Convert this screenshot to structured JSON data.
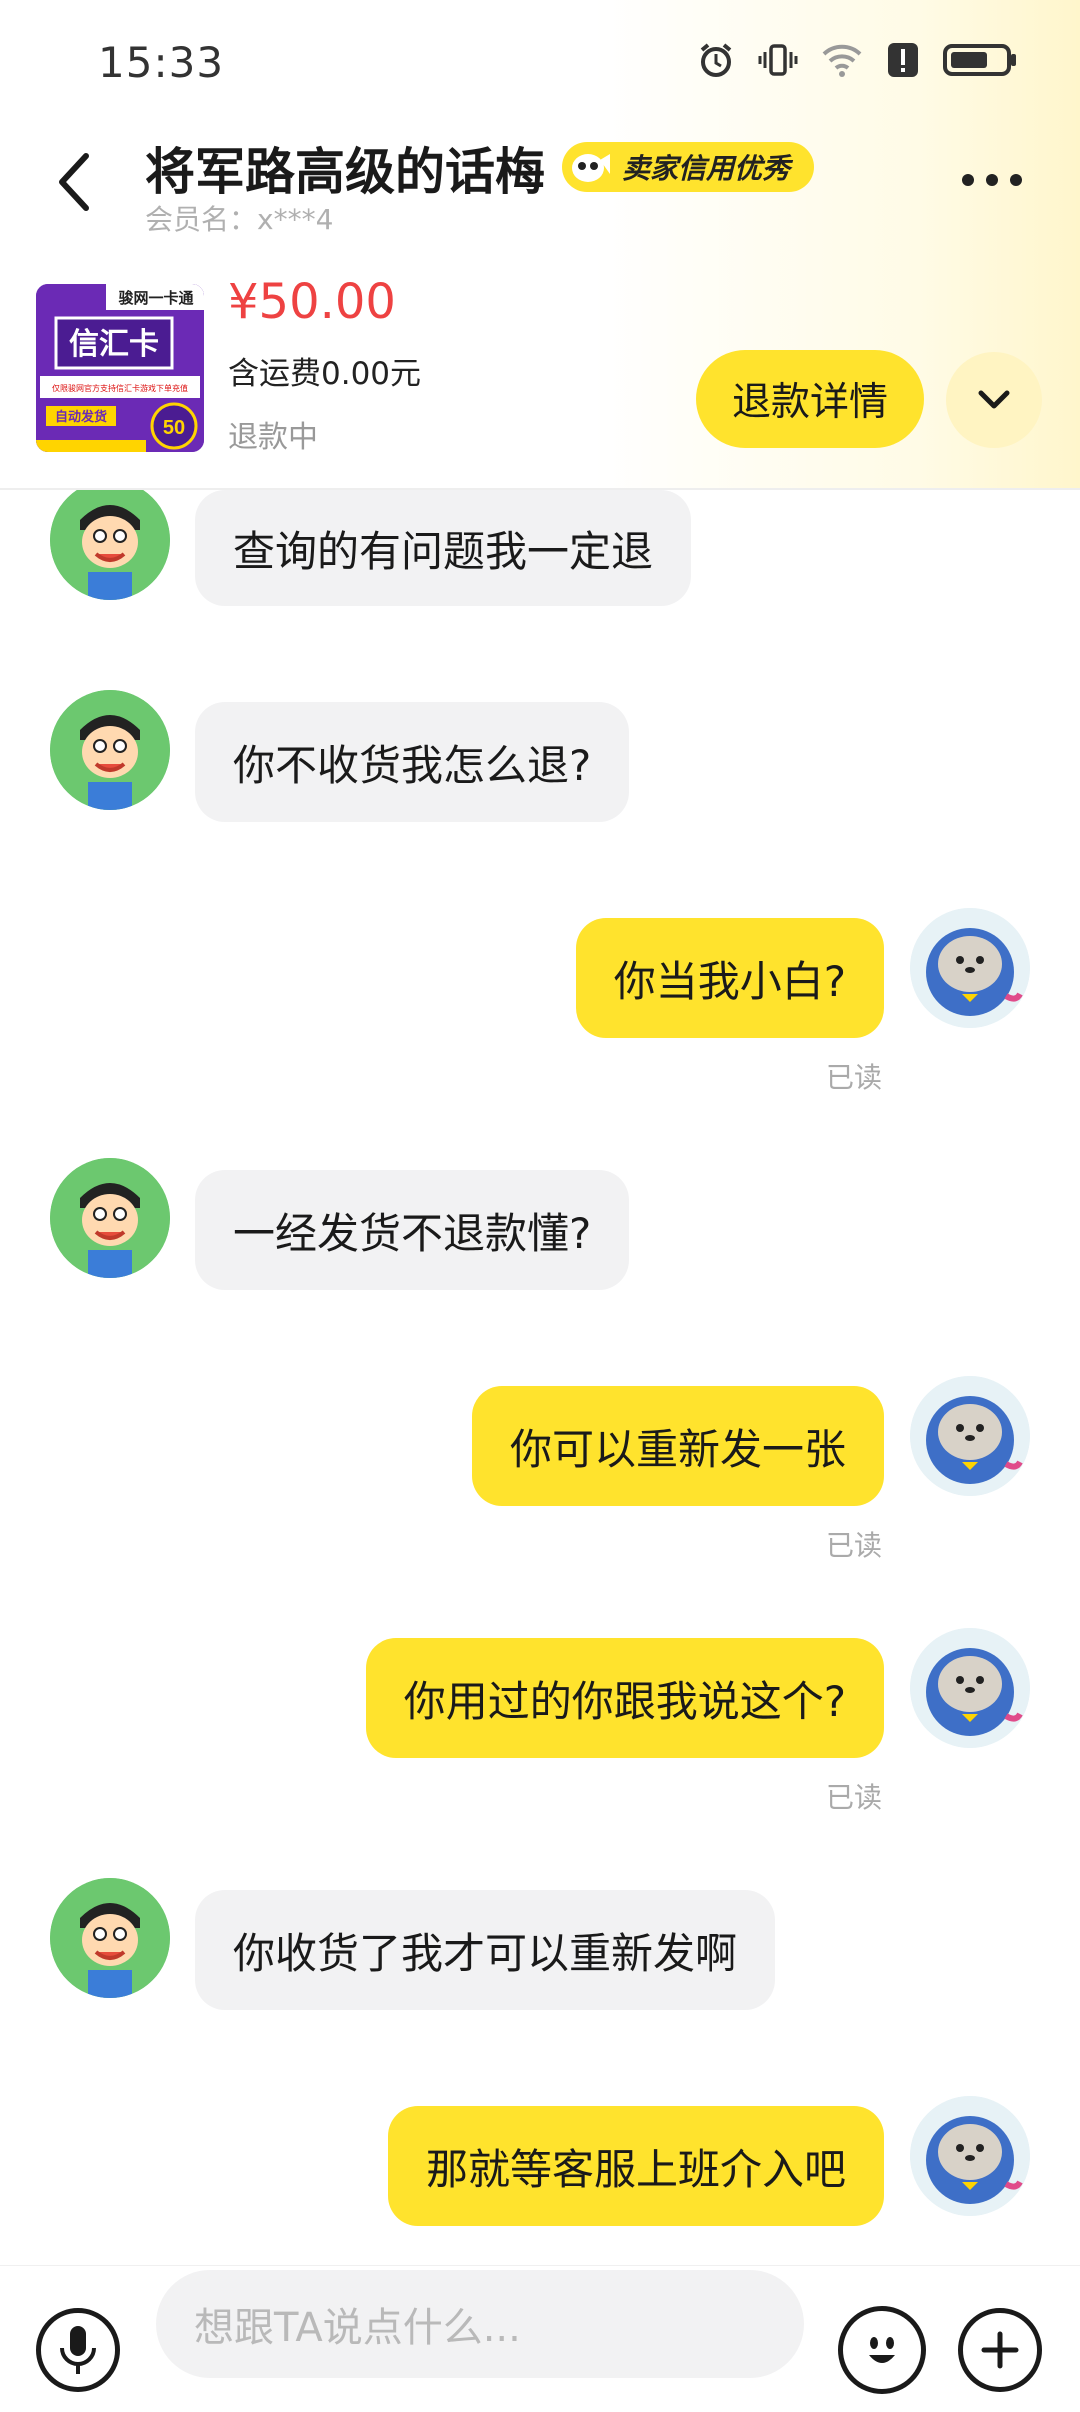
{
  "status_bar": {
    "time": "15:33",
    "icons": [
      "alarm-icon",
      "vibrate-icon",
      "wifi-icon",
      "alert-icon",
      "battery-icon"
    ]
  },
  "header": {
    "title": "将军路高级的话梅",
    "badge": "卖家信用优秀",
    "member": "会员名：x***4"
  },
  "product": {
    "image_texts": {
      "brand": "骏网一卡通",
      "name": "信汇卡",
      "note": "仅限骏网官方支持信汇卡游戏下单充值",
      "tag": "自动发货",
      "value": "50"
    },
    "price": "¥50.00",
    "shipping": "含运费0.00元",
    "status": "退款中",
    "refund_button": "退款详情"
  },
  "messages": [
    {
      "side": "left",
      "text": "查询的有问题我一定退"
    },
    {
      "side": "left",
      "text": "你不收货我怎么退?"
    },
    {
      "side": "right",
      "text": "你当我小白?",
      "read": "已读"
    },
    {
      "side": "left",
      "text": "一经发货不退款懂?"
    },
    {
      "side": "right",
      "text": "你可以重新发一张",
      "read": "已读"
    },
    {
      "side": "right",
      "text": "你用过的你跟我说这个?",
      "read": "已读"
    },
    {
      "side": "left",
      "text": "你收货了我才可以重新发啊"
    },
    {
      "side": "right",
      "text": "那就等客服上班介入吧"
    }
  ],
  "input": {
    "placeholder": "想跟TA说点什么..."
  },
  "colors": {
    "accent": "#ffe32d",
    "price": "#ee4242",
    "left_bubble": "#f2f2f3"
  }
}
